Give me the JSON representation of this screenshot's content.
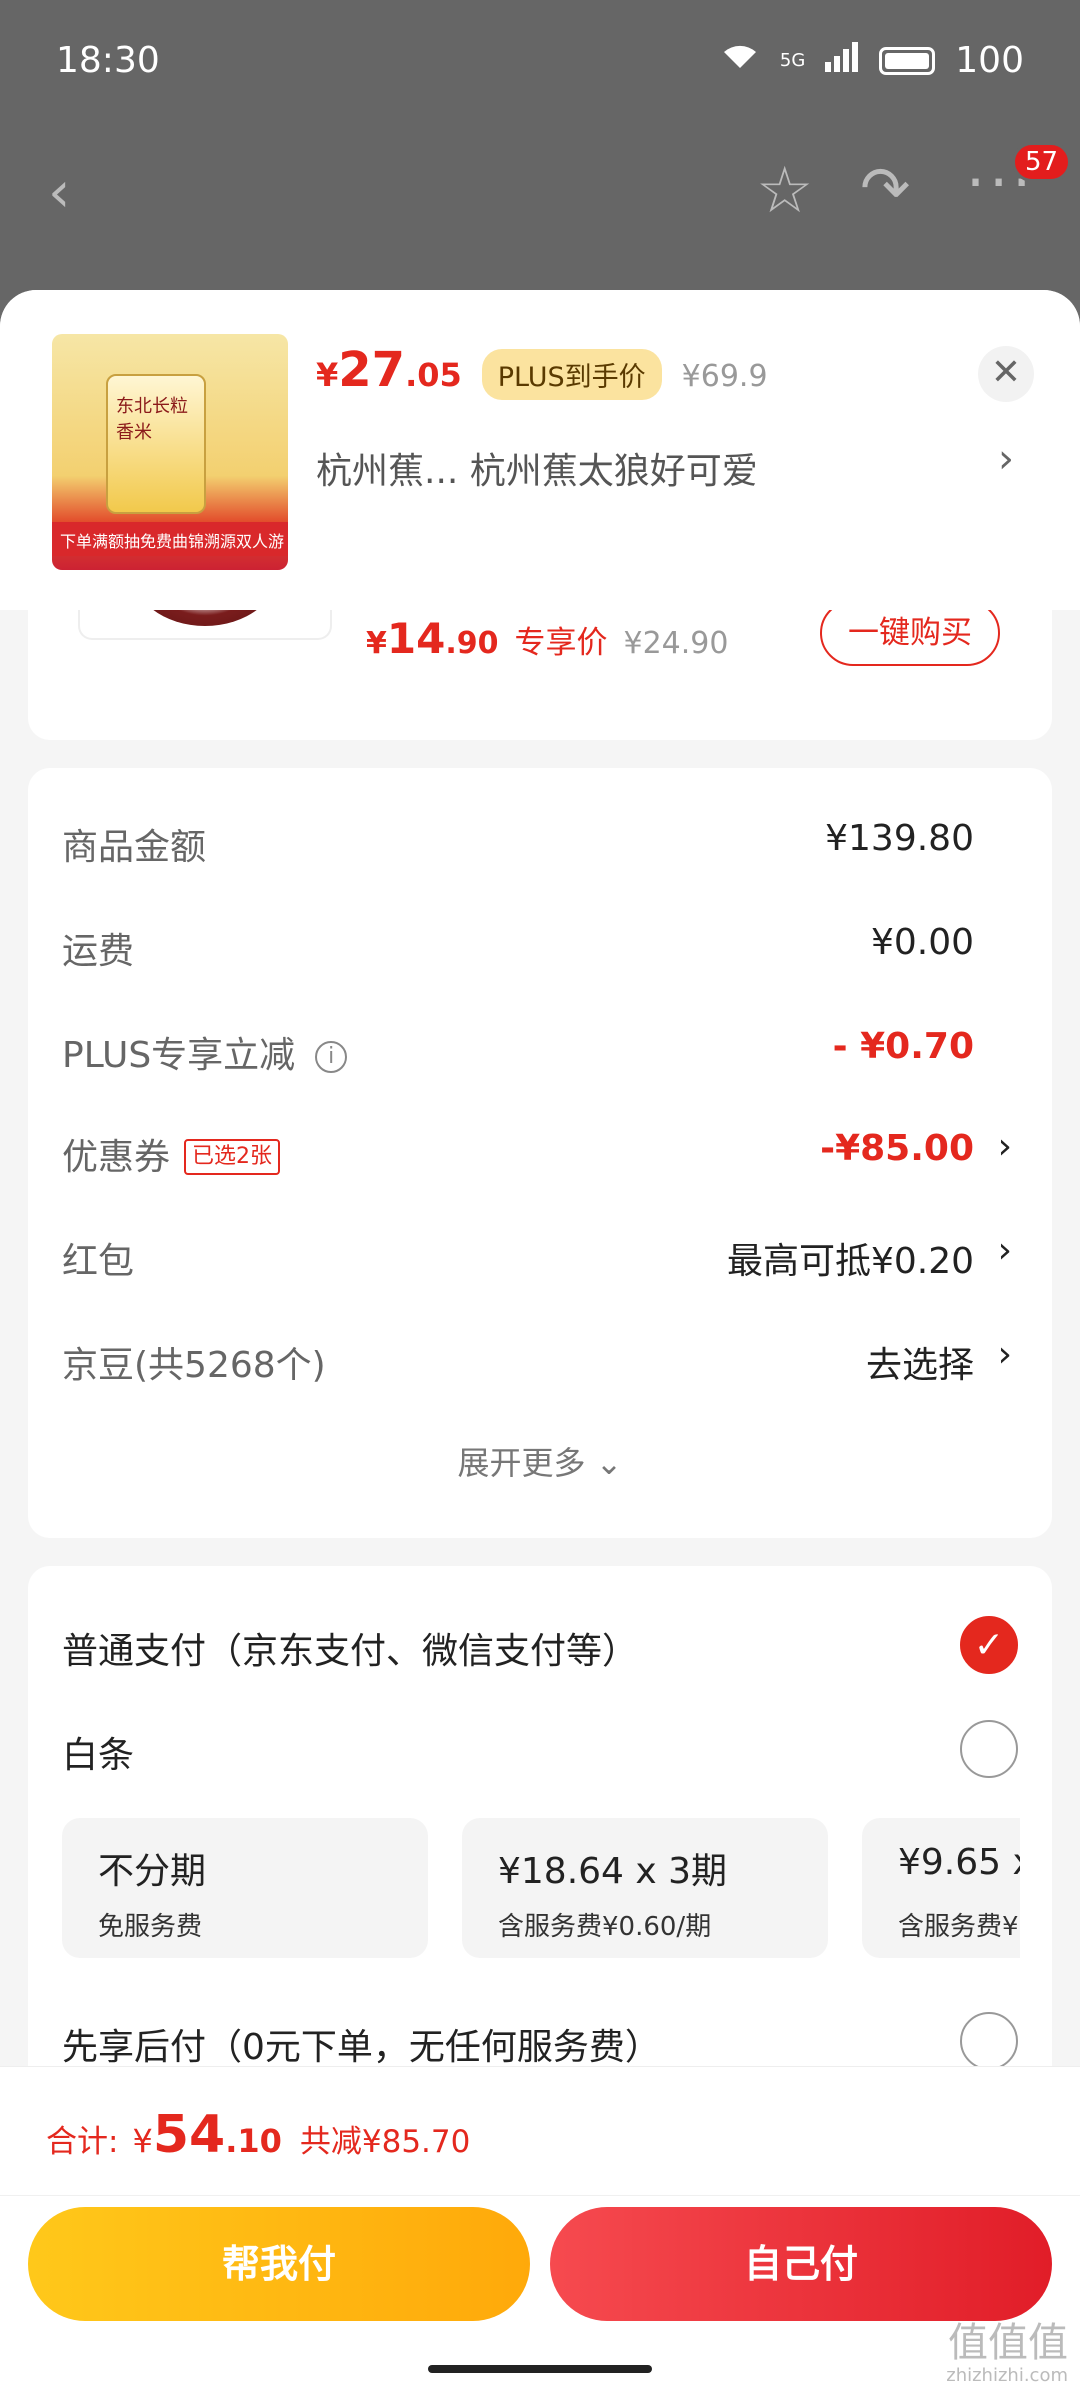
{
  "status": {
    "time": "18:30",
    "network": "5G",
    "battery": "100"
  },
  "nav": {
    "back_icon": "‹",
    "star_icon": "☆",
    "share_icon": "↷",
    "more_icon": "···",
    "badge": "57"
  },
  "header": {
    "price_currency": "¥",
    "price_int": "27",
    "price_dec": ".05",
    "plus_tag": "PLUS到手价",
    "old_price": "¥69.9",
    "address": "杭州蕉...  杭州蕉太狼好可爱",
    "product_bag_text": "东北长粒香米",
    "product_banner": "下单满额抽免费曲锦溯源双人游"
  },
  "promo": {
    "price_currency": "¥",
    "price_int": "14",
    "price_dec": ".90",
    "label": "专享价",
    "old_price": "¥24.90",
    "buy_button": "一键购买"
  },
  "summary": {
    "goods_amount_label": "商品金额",
    "goods_amount_value": "¥139.80",
    "shipping_label": "运费",
    "shipping_value": "¥0.00",
    "plus_discount_label": "PLUS专享立减",
    "plus_discount_value": "- ¥0.70",
    "coupon_label": "优惠券",
    "coupon_chip": "已选2张",
    "coupon_value": "-¥85.00",
    "redpacket_label": "红包",
    "redpacket_value": "最高可抵¥0.20",
    "jingdou_label": "京豆(共5268个)",
    "jingdou_value": "去选择",
    "expand_more": "展开更多 ⌄"
  },
  "payment": {
    "normal_label": "普通支付（京东支付、微信支付等）",
    "baitiao_label": "白条",
    "plans": [
      {
        "title": "不分期",
        "sub": "免服务费"
      },
      {
        "title": "¥18.64 x 3期",
        "sub": "含服务费¥0.60/期"
      },
      {
        "title": "¥9.65 x",
        "sub": "含服务费¥"
      }
    ],
    "paylater_label": "先享后付（0元下单，无任何服务费）"
  },
  "footer": {
    "total_label": "合计:",
    "total_currency": "¥",
    "total_int": "54",
    "total_dec": ".10",
    "total_saved": "共减¥85.70",
    "help_pay": "帮我付",
    "self_pay": "自己付",
    "watermark": "值值值",
    "watermark_domain": "zhizhizhi.com"
  },
  "colors": {
    "accent_red": "#e4281e",
    "help_yellow": "#ffb311",
    "plus_tag_bg": "#fbe39f"
  }
}
